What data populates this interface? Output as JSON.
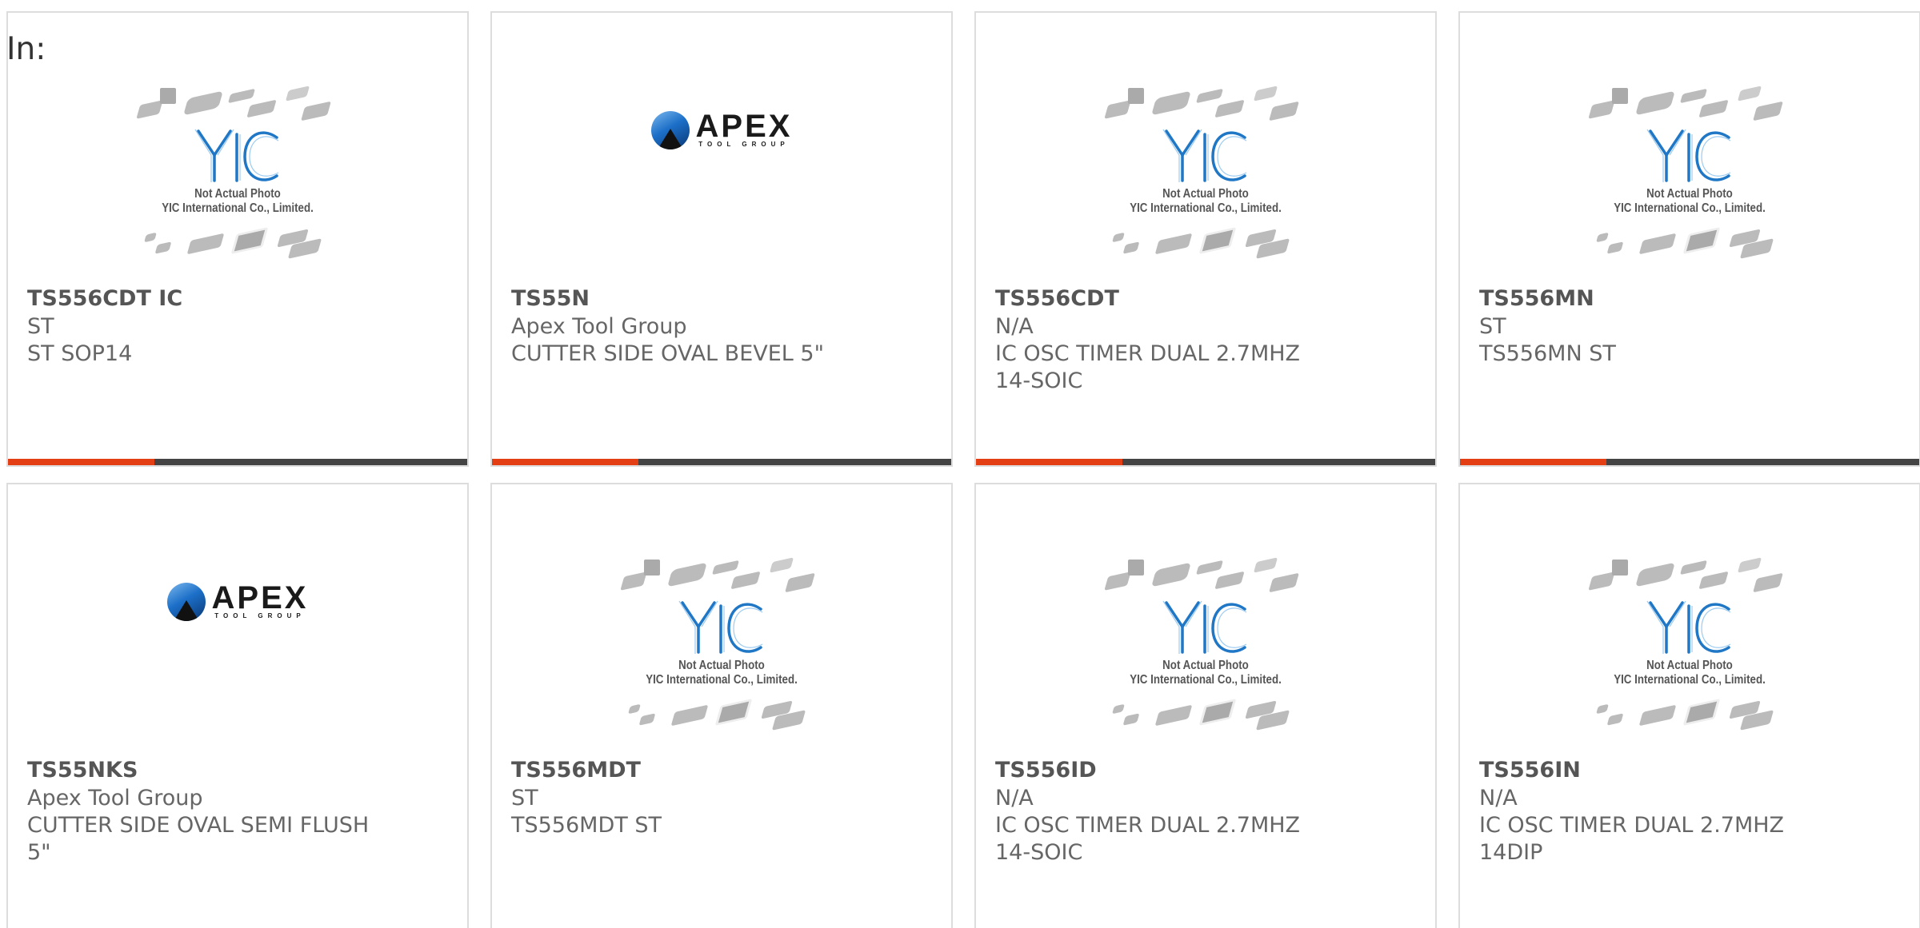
{
  "filter": {
    "label": "In:"
  },
  "colors": {
    "accent": "#e33e14",
    "bar": "#444444"
  },
  "placeholder": {
    "line1": "Not Actual Photo",
    "line2": "YIC International Co., Limited."
  },
  "apex_logo": {
    "name": "APEX",
    "tagline": "TOOL GROUP"
  },
  "products": [
    {
      "part": "TS556CDT IC",
      "manufacturer": "ST",
      "description": "ST SOP14",
      "image": "yic-placeholder"
    },
    {
      "part": "TS55N",
      "manufacturer": "Apex Tool Group",
      "description": "CUTTER SIDE OVAL BEVEL 5\"",
      "image": "apex-logo"
    },
    {
      "part": "TS556CDT",
      "manufacturer": "N/A",
      "description": "IC OSC TIMER DUAL 2.7MHZ 14-SOIC",
      "image": "yic-placeholder"
    },
    {
      "part": "TS556MN",
      "manufacturer": "ST",
      "description": "TS556MN ST",
      "image": "yic-placeholder"
    },
    {
      "part": "TS55NKS",
      "manufacturer": "Apex Tool Group",
      "description": "CUTTER SIDE OVAL SEMI FLUSH 5\"",
      "image": "apex-logo"
    },
    {
      "part": "TS556MDT",
      "manufacturer": "ST",
      "description": "TS556MDT ST",
      "image": "yic-placeholder"
    },
    {
      "part": "TS556ID",
      "manufacturer": "N/A",
      "description": "IC OSC TIMER DUAL 2.7MHZ 14-SOIC",
      "image": "yic-placeholder"
    },
    {
      "part": "TS556IN",
      "manufacturer": "N/A",
      "description": "IC OSC TIMER DUAL 2.7MHZ 14DIP",
      "image": "yic-placeholder"
    }
  ]
}
